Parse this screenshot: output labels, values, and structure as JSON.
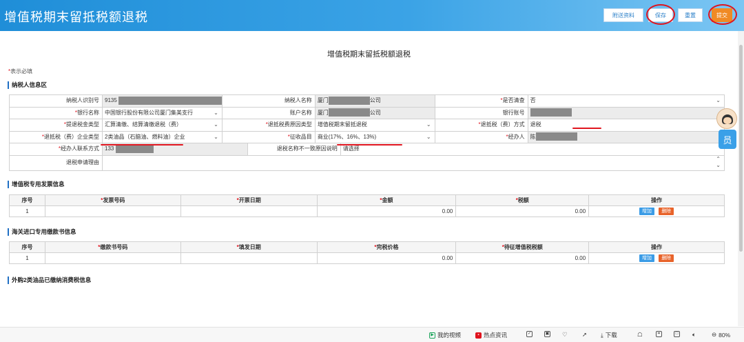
{
  "header": {
    "title": "增值税期末留抵税额退税",
    "buttons": {
      "attachments": "附送资料",
      "save": "保存",
      "reset": "重置",
      "submit": "提交"
    }
  },
  "page_title": "增值税期末留抵税额退税",
  "required_note": "表示必填",
  "taxpayer_section": {
    "title": "纳税人信息区",
    "rows": [
      {
        "l1": "纳税人识别号",
        "v1": "9135",
        "l2": "纳税人名称",
        "v2a": "厦门",
        "v2b": "公司",
        "l3": "是否清查",
        "v3": "否"
      },
      {
        "l1": "银行名称",
        "v1": "中国银行股份有限公司厦门集美支行",
        "l2": "账户名称",
        "v2a": "厦门",
        "v2b": "公司",
        "l3": "银行账号",
        "v3": ""
      },
      {
        "l1": "提退税金类型",
        "v1": "汇算清缴、结算清缴退税（费）",
        "l2": "退抵税费原因类型",
        "v2": "增值税期末留抵退税",
        "l3": "退抵税（费）方式",
        "v3": "退税"
      },
      {
        "l1": "退抵税（费）企业类型",
        "v1": "2类油品（石脑油、燃料油）企业",
        "l2": "征收品目",
        "v2": "商业(17%、16%、13%)",
        "l3": "经办人",
        "v3": "陈"
      },
      {
        "l1": "经办人联系方式",
        "v1": "133",
        "l2": "退税名称不一致原因说明",
        "v2": "请选择"
      },
      {
        "l1": "退税申请理由",
        "v1": ""
      }
    ]
  },
  "vat_invoice_section": {
    "title": "增值税专用发票信息",
    "columns": [
      "序号",
      "发票号码",
      "开票日期",
      "金额",
      "税额",
      "操作"
    ],
    "rows": [
      {
        "index": "1",
        "amount": "0.00",
        "tax": "0.00"
      }
    ],
    "actions": {
      "add": "增加",
      "delete": "删除"
    }
  },
  "customs_section": {
    "title": "海关进口专用缴款书信息",
    "columns": [
      "序号",
      "缴款书号码",
      "填发日期",
      "完税价格",
      "待征增值税税额",
      "操作"
    ],
    "rows": [
      {
        "index": "1",
        "price": "0.00",
        "tax": "0.00"
      }
    ],
    "actions": {
      "add": "增加",
      "delete": "删除"
    }
  },
  "outsourced_section": {
    "title": "外购2类油品已缴纳消费税信息"
  },
  "assistant": {
    "label": "员"
  },
  "statusbar": {
    "my_video": "我的视频",
    "hot_news": "热点资讯",
    "download": "下载",
    "zoom": "80%"
  }
}
